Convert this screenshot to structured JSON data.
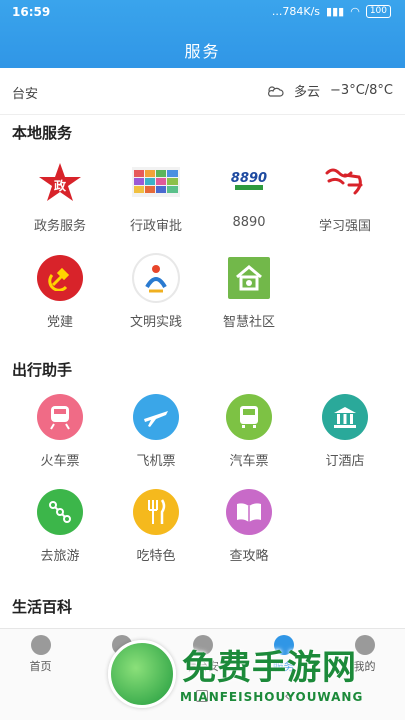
{
  "status": {
    "time": "16:59",
    "network": "...784K/s",
    "battery": "100"
  },
  "header": {
    "title": "服务"
  },
  "weather": {
    "city": "台安",
    "condition": "多云",
    "temperature": "−3°C/8°C"
  },
  "sections": {
    "local": {
      "title": "本地服务",
      "items": [
        {
          "label": "政务服务",
          "icon": "gov-star-icon"
        },
        {
          "label": "行政审批",
          "icon": "approval-grid-icon"
        },
        {
          "label": "8890",
          "icon": "hotline-8890-icon"
        },
        {
          "label": "学习强国",
          "icon": "xuexi-icon"
        },
        {
          "label": "党建",
          "icon": "party-emblem-icon"
        },
        {
          "label": "文明实践",
          "icon": "civilization-icon"
        },
        {
          "label": "智慧社区",
          "icon": "smart-community-icon"
        }
      ]
    },
    "travel": {
      "title": "出行助手",
      "items": [
        {
          "label": "火车票",
          "icon": "train-icon",
          "color": "#f06b86"
        },
        {
          "label": "飞机票",
          "icon": "plane-icon",
          "color": "#3aa6e8"
        },
        {
          "label": "汽车票",
          "icon": "bus-icon",
          "color": "#7dc244"
        },
        {
          "label": "订酒店",
          "icon": "hotel-icon",
          "color": "#2aa99a"
        },
        {
          "label": "去旅游",
          "icon": "route-icon",
          "color": "#3cb64a"
        },
        {
          "label": "吃特色",
          "icon": "food-icon",
          "color": "#f5b91d"
        },
        {
          "label": "查攻略",
          "icon": "guide-book-icon",
          "color": "#c86ac8"
        }
      ]
    },
    "life": {
      "title": "生活百科"
    }
  },
  "bottom_nav": {
    "items": [
      {
        "label": "首页"
      },
      {
        "label": "视频"
      },
      {
        "label": "看台安"
      },
      {
        "label": "服务"
      },
      {
        "label": "我的"
      }
    ]
  },
  "watermark": {
    "text": "免费手游网",
    "sub": "MIANFEISHOUYOUWANG"
  }
}
